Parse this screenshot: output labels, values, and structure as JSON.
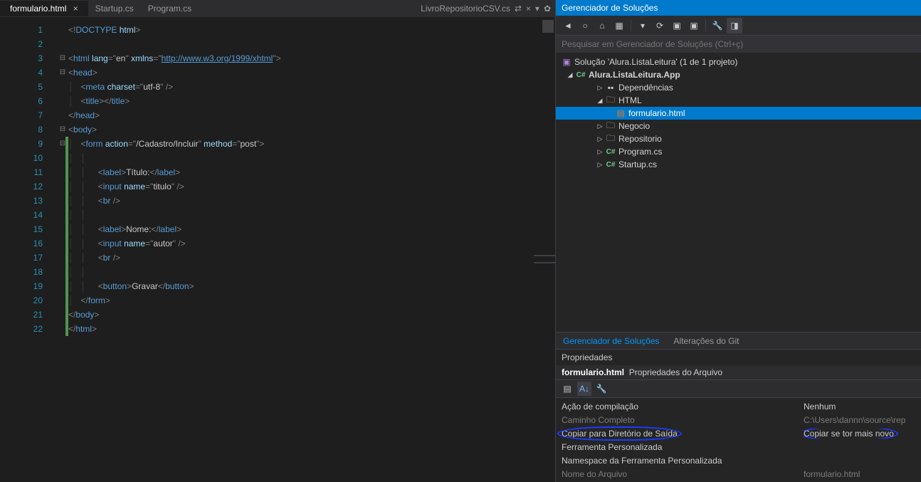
{
  "tabs": {
    "active": "formulario.html",
    "others": [
      "Startup.cs",
      "Program.cs"
    ],
    "right_label": "LivroRepositorioCSV.cs"
  },
  "code": {
    "lines": [
      {
        "n": 1,
        "fold": "",
        "green": false,
        "html": "<span class='c-punc'>&lt;!</span><span class='c-tag'>DOCTYPE</span> <span class='c-attr'>html</span><span class='c-punc'>&gt;</span>"
      },
      {
        "n": 2,
        "fold": "",
        "green": false,
        "html": ""
      },
      {
        "n": 3,
        "fold": "⊟",
        "green": false,
        "html": "<span class='c-punc'>&lt;</span><span class='c-tag'>html</span> <span class='c-attr'>lang</span><span class='c-punc'>=\"</span><span class='c-str'>en</span><span class='c-punc'>\"</span> <span class='c-attr'>xmlns</span><span class='c-punc'>=\"</span><span class='c-link'>http://www.w3.org/1999/xhtml</span><span class='c-punc'>\"&gt;</span>"
      },
      {
        "n": 4,
        "fold": "⊟",
        "green": false,
        "html": "<span class='c-punc'>&lt;</span><span class='c-tag'>head</span><span class='c-punc'>&gt;</span>"
      },
      {
        "n": 5,
        "fold": "",
        "green": false,
        "html": "<span class='guide'>│   </span><span class='c-punc'>&lt;</span><span class='c-tag'>meta</span> <span class='c-attr'>charset</span><span class='c-punc'>=\"</span><span class='c-str'>utf-8</span><span class='c-punc'>\" /&gt;</span>"
      },
      {
        "n": 6,
        "fold": "",
        "green": false,
        "html": "<span class='guide'>│   </span><span class='c-punc'>&lt;</span><span class='c-tag'>title</span><span class='c-punc'>&gt;&lt;/</span><span class='c-tag'>title</span><span class='c-punc'>&gt;</span>"
      },
      {
        "n": 7,
        "fold": "",
        "green": false,
        "html": "<span class='c-punc'>&lt;/</span><span class='c-tag'>head</span><span class='c-punc'>&gt;</span>"
      },
      {
        "n": 8,
        "fold": "⊟",
        "green": false,
        "html": "<span class='c-punc'>&lt;</span><span class='c-tag'>body</span><span class='c-punc'>&gt;</span>"
      },
      {
        "n": 9,
        "fold": "⊟",
        "green": true,
        "html": "<span class='guide'>│   </span><span class='c-punc'>&lt;</span><span class='c-tag'>form</span> <span class='c-attr'>action</span><span class='c-punc'>=\"</span><span class='c-str'>/Cadastro/Incluir</span><span class='c-punc'>\"</span> <span class='c-attr'>method</span><span class='c-punc'>=\"</span><span class='c-str'>post</span><span class='c-punc'>\"&gt;</span>"
      },
      {
        "n": 10,
        "fold": "",
        "green": true,
        "html": "<span class='guide'>│   │   </span>"
      },
      {
        "n": 11,
        "fold": "",
        "green": true,
        "html": "<span class='guide'>│   │   </span>  <span class='c-punc'>&lt;</span><span class='c-tag'>label</span><span class='c-punc'>&gt;</span><span class='c-txt'>Título:</span><span class='c-punc'>&lt;/</span><span class='c-tag'>label</span><span class='c-punc'>&gt;</span>"
      },
      {
        "n": 12,
        "fold": "",
        "green": true,
        "html": "<span class='guide'>│   │   </span>  <span class='c-punc'>&lt;</span><span class='c-tag'>input</span> <span class='c-attr'>name</span><span class='c-punc'>=\"</span><span class='c-str'>titulo</span><span class='c-punc'>\" /&gt;</span>"
      },
      {
        "n": 13,
        "fold": "",
        "green": true,
        "html": "<span class='guide'>│   │   </span>  <span class='c-punc'>&lt;</span><span class='c-tag'>br</span> <span class='c-punc'>/&gt;</span>"
      },
      {
        "n": 14,
        "fold": "",
        "green": true,
        "html": "<span class='guide'>│   │   </span>"
      },
      {
        "n": 15,
        "fold": "",
        "green": true,
        "html": "<span class='guide'>│   │   </span>  <span class='c-punc'>&lt;</span><span class='c-tag'>label</span><span class='c-punc'>&gt;</span><span class='c-txt'>Nome:</span><span class='c-punc'>&lt;/</span><span class='c-tag'>label</span><span class='c-punc'>&gt;</span>"
      },
      {
        "n": 16,
        "fold": "",
        "green": true,
        "html": "<span class='guide'>│   │   </span>  <span class='c-punc'>&lt;</span><span class='c-tag'>input</span> <span class='c-attr'>name</span><span class='c-punc'>=\"</span><span class='c-str'>autor</span><span class='c-punc'>\" /&gt;</span>"
      },
      {
        "n": 17,
        "fold": "",
        "green": true,
        "html": "<span class='guide'>│   │   </span>  <span class='c-punc'>&lt;</span><span class='c-tag'>br</span> <span class='c-punc'>/&gt;</span>"
      },
      {
        "n": 18,
        "fold": "",
        "green": true,
        "html": "<span class='guide'>│   │   </span>"
      },
      {
        "n": 19,
        "fold": "",
        "green": true,
        "html": "<span class='guide'>│   │   </span>  <span class='c-punc'>&lt;</span><span class='c-tag'>button</span><span class='c-punc'>&gt;</span><span class='c-txt'>Gravar</span><span class='c-punc'>&lt;/</span><span class='c-tag'>button</span><span class='c-punc'>&gt;</span>"
      },
      {
        "n": 20,
        "fold": "",
        "green": true,
        "html": "<span class='guide'>│   </span><span class='c-punc'>&lt;/</span><span class='c-tag'>form</span><span class='c-punc'>&gt;</span>"
      },
      {
        "n": 21,
        "fold": "",
        "green": true,
        "html": "<span class='c-punc'>&lt;/</span><span class='c-tag'>body</span><span class='c-punc'>&gt;</span>"
      },
      {
        "n": 22,
        "fold": "",
        "green": true,
        "html": "<span class='c-punc'>&lt;/</span><span class='c-tag'>html</span><span class='c-punc'>&gt;</span>"
      }
    ]
  },
  "solution_panel": {
    "title": "Gerenciador de Soluções",
    "search_placeholder": "Pesquisar em Gerenciador de Soluções (Ctrl+ç)",
    "root": "Solução 'Alura.ListaLeitura' (1 de 1 projeto)",
    "project": "Alura.ListaLeitura.App",
    "items": [
      {
        "indent": 3,
        "arrow": "▷",
        "icon": "dep",
        "label": "Dependências"
      },
      {
        "indent": 3,
        "arrow": "◢",
        "icon": "folder",
        "label": "HTML"
      },
      {
        "indent": 4,
        "arrow": "",
        "icon": "html",
        "label": "formulario.html",
        "selected": true
      },
      {
        "indent": 3,
        "arrow": "▷",
        "icon": "folder",
        "label": "Negocio"
      },
      {
        "indent": 3,
        "arrow": "▷",
        "icon": "folder",
        "label": "Repositorio"
      },
      {
        "indent": 3,
        "arrow": "▷",
        "icon": "cs",
        "label": "Program.cs"
      },
      {
        "indent": 3,
        "arrow": "▷",
        "icon": "cs",
        "label": "Startup.cs"
      }
    ]
  },
  "bottom_tabs": {
    "active": "Gerenciador de Soluções",
    "other": "Alterações do Git"
  },
  "properties": {
    "title": "Propriedades",
    "subtitle_file": "formulario.html",
    "subtitle_rest": "Propriedades do Arquivo",
    "rows": [
      {
        "k": "Ação de compilação",
        "v": "Nenhum",
        "dim": false,
        "circle": false
      },
      {
        "k": "Caminho Completo",
        "v": "C:\\Users\\dannn\\source\\rep",
        "dim": true,
        "circle": false
      },
      {
        "k": "Copiar para Diretório de Saída",
        "v": "Copiar se tor mais novo",
        "dim": false,
        "circle": true
      },
      {
        "k": "Ferramenta Personalizada",
        "v": "",
        "dim": false,
        "circle": false
      },
      {
        "k": "Namespace da Ferramenta Personalizada",
        "v": "",
        "dim": false,
        "circle": false
      },
      {
        "k": "Nome do Arquivo",
        "v": "formulario.html",
        "dim": true,
        "circle": false
      }
    ]
  }
}
